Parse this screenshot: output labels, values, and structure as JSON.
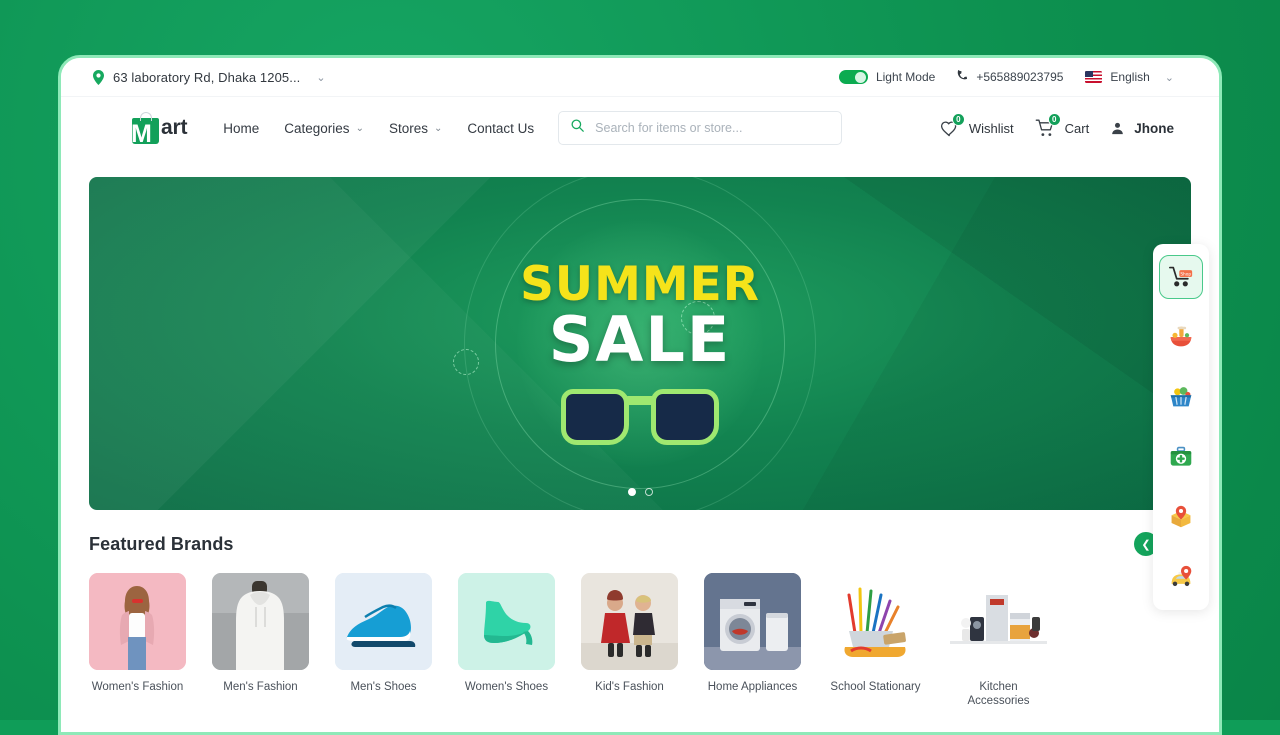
{
  "utilbar": {
    "location": "63 laboratory Rd, Dhaka 1205...",
    "location_icon": "map-pin-icon",
    "location_caret": "⌄",
    "theme_label": "Light Mode",
    "theme_icon": "toggle-on-icon",
    "phone": "+565889023795",
    "phone_icon": "phone-icon",
    "language": "English",
    "language_flag": "us-flag-icon",
    "language_caret": "⌄"
  },
  "nav": {
    "logo_m": "M",
    "logo_rest": "art",
    "logo_icon": "shopping-bag-icon",
    "links": [
      {
        "label": "Home",
        "caret": ""
      },
      {
        "label": "Categories",
        "caret": "⌄"
      },
      {
        "label": "Stores",
        "caret": "⌄"
      },
      {
        "label": "Contact Us",
        "caret": ""
      }
    ],
    "search": {
      "placeholder": "Search for items or store...",
      "value": "",
      "icon": "search-icon"
    },
    "wishlist": {
      "label": "Wishlist",
      "count": "0",
      "icon": "heart-icon"
    },
    "cart": {
      "label": "Cart",
      "count": "0",
      "icon": "shopping-cart-icon"
    },
    "user": {
      "name": "Jhone",
      "icon": "user-icon"
    }
  },
  "hero": {
    "title_top": "SUMMER",
    "title_bottom": "SALE",
    "title_top_color": "#f5e31a",
    "title_bottom_color": "#ffffff",
    "graphic": "sunglasses-icon",
    "slides": [
      {
        "active": true
      },
      {
        "active": false
      }
    ]
  },
  "featured": {
    "title": "Featured Brands",
    "prev_icon": "chevron-left-icon",
    "next_icon": "chevron-right-icon",
    "prev_glyph": "❮",
    "next_glyph": "❯",
    "brands": [
      {
        "label": "Women's Fashion",
        "bg": "#f6bfc6",
        "art": "woman-pink"
      },
      {
        "label": "Men's Fashion",
        "bg": "#b8bbbd",
        "art": "hoodie-gray"
      },
      {
        "label": "Men's Shoes",
        "bg": "#e3ecf5",
        "art": "sneaker-blue"
      },
      {
        "label": "Women's Shoes",
        "bg": "#ccf2e8",
        "art": "heel-mint"
      },
      {
        "label": "Kid's Fashion",
        "bg": "#e8e4dd",
        "art": "kids-beige"
      },
      {
        "label": "Home Appliances",
        "bg": "#61718f",
        "art": "washer-slate"
      },
      {
        "label": "School Stationary",
        "bg": "#ffffff",
        "art": "pencils-white"
      },
      {
        "label": "Kitchen Accessories",
        "bg": "#ffffff",
        "art": "appliances-white"
      }
    ]
  },
  "rail": {
    "items": [
      {
        "icon": "shopping-cart-icon",
        "glyph": "🛒",
        "active": true
      },
      {
        "icon": "food-bowl-icon",
        "glyph": "🍜",
        "active": false
      },
      {
        "icon": "grocery-basket-icon",
        "glyph": "🧺",
        "active": false
      },
      {
        "icon": "medical-kit-icon",
        "glyph": "🧰",
        "active": false
      },
      {
        "icon": "parcel-pin-icon",
        "glyph": "📦",
        "active": false
      },
      {
        "icon": "taxi-pin-icon",
        "glyph": "🚕",
        "active": false
      }
    ]
  },
  "colors": {
    "brand_green": "#13a05a",
    "desk_green": "#0f9d58",
    "hero_green": "#128350",
    "accent_yellow": "#f5e31a"
  }
}
